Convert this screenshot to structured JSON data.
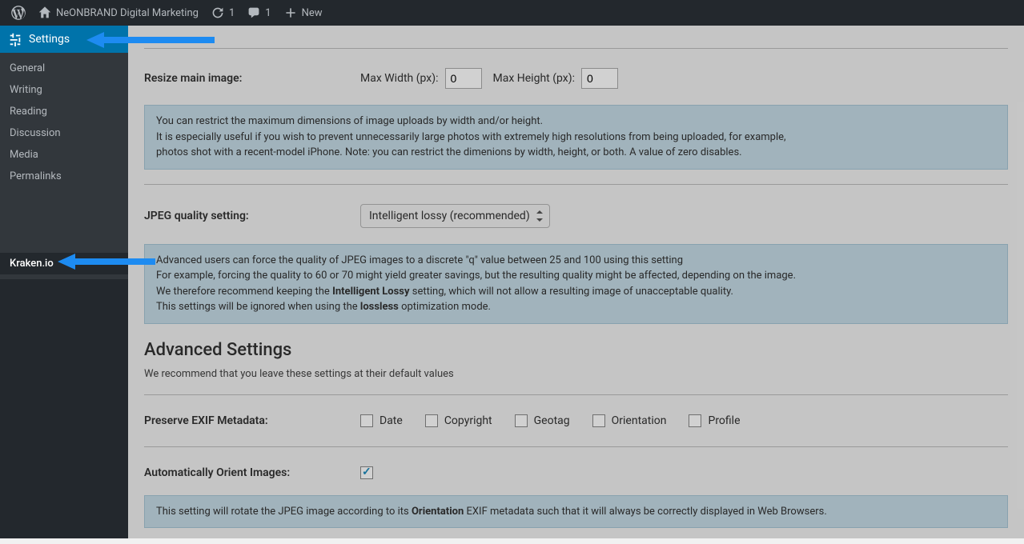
{
  "adminbar": {
    "site_title": "NeONBRAND Digital Marketing",
    "refresh_count": "1",
    "comment_count": "1",
    "new_label": "New"
  },
  "sidebar": {
    "top_label": "Settings",
    "items": [
      {
        "label": "General"
      },
      {
        "label": "Writing"
      },
      {
        "label": "Reading"
      },
      {
        "label": "Discussion"
      },
      {
        "label": "Media"
      },
      {
        "label": "Permalinks"
      }
    ],
    "kraken_label": "Kraken.io"
  },
  "resize": {
    "label": "Resize main image:",
    "max_w_label": "Max Width (px):",
    "max_w_value": "0",
    "max_h_label": "Max Height (px):",
    "max_h_value": "0",
    "help_l1": "You can restrict the maximum dimensions of image uploads by width and/or height.",
    "help_l2": "It is especially useful if you wish to prevent unnecessarily large photos with extremely high resolutions from being uploaded, for example,",
    "help_l3": "photos shot with a recent-model iPhone. Note: you can restrict the dimenions by width, height, or both. A value of zero disables."
  },
  "jpeg": {
    "label": "JPEG quality setting:",
    "select_value": "Intelligent lossy (recommended)",
    "help_l1": "Advanced users can force the quality of JPEG images to a discrete \"q\" value between 25 and 100 using this setting",
    "help_l2": "For example, forcing the quality to 60 or 70 might yield greater savings, but the resulting quality might be affected, depending on the image.",
    "help_l3a": "We therefore recommend keeping the ",
    "help_l3b": "Intelligent Lossy",
    "help_l3c": " setting, which will not allow a resulting image of unacceptable quality.",
    "help_l4a": "This settings will be ignored when using the ",
    "help_l4b": "lossless",
    "help_l4c": " optimization mode."
  },
  "advanced": {
    "title": "Advanced Settings",
    "subtitle": "We recommend that you leave these settings at their default values",
    "exif_label": "Preserve EXIF Metadata:",
    "exif_options": {
      "date": "Date",
      "copyright": "Copyright",
      "geotag": "Geotag",
      "orientation": "Orientation",
      "profile": "Profile"
    },
    "orient_label": "Automatically Orient Images:",
    "orient_help_a": "This setting will rotate the JPEG image according to its ",
    "orient_help_b": "Orientation",
    "orient_help_c": " EXIF metadata such that it will always be correctly displayed in Web Browsers."
  }
}
